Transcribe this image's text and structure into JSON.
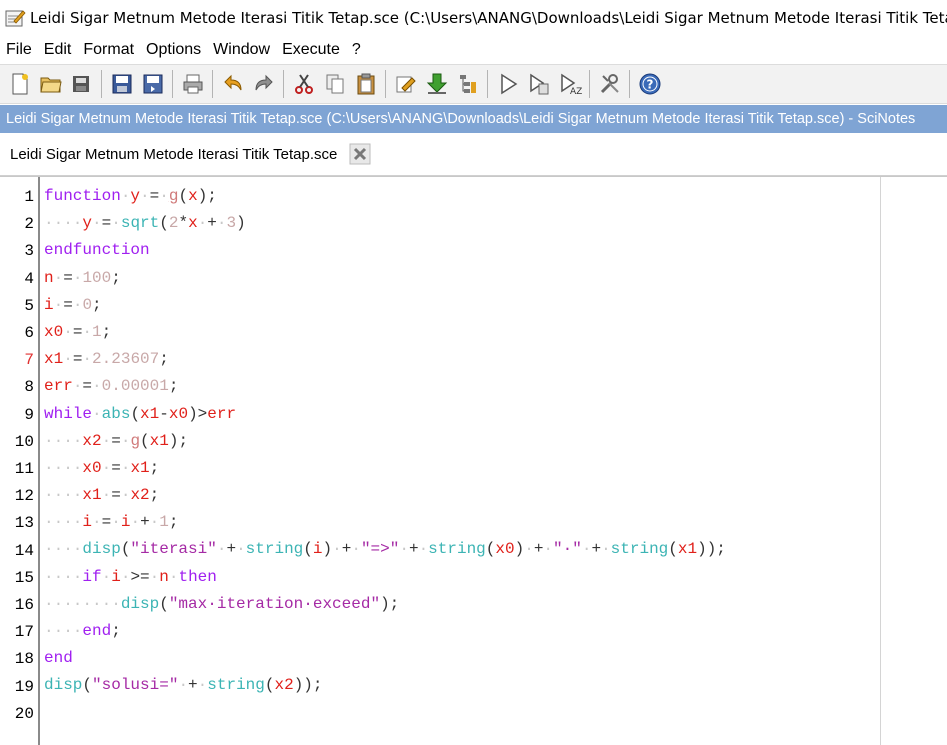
{
  "window": {
    "title": "Leidi Sigar Metnum Metode Iterasi Titik Tetap.sce (C:\\Users\\ANANG\\Downloads\\Leidi Sigar Metnum Metode Iterasi Titik Tetap.sce) - SciNotes"
  },
  "menu": {
    "items": [
      "File",
      "Edit",
      "Format",
      "Options",
      "Window",
      "Execute",
      "?"
    ]
  },
  "toolbar": {
    "icons": [
      "new-file-icon",
      "open-file-icon",
      "open-directory-icon",
      "save-icon",
      "save-as-icon",
      "print-icon",
      "undo-icon",
      "redo-icon",
      "cut-icon",
      "copy-icon",
      "paste-icon",
      "find-replace-icon",
      "load-into-scilab-icon",
      "variable-browser-icon",
      "execute-icon",
      "execute-file-icon",
      "execute-until-cursor-icon",
      "preferences-icon",
      "help-icon"
    ]
  },
  "pathbar": {
    "text": "Leidi Sigar Metnum Metode Iterasi Titik Tetap.sce (C:\\Users\\ANANG\\Downloads\\Leidi Sigar Metnum Metode Iterasi Titik Tetap.sce) - SciNotes"
  },
  "tab": {
    "label": "Leidi Sigar Metnum Metode Iterasi Titik Tetap.sce"
  },
  "editor": {
    "line_numbers": [
      "1",
      "2",
      "3",
      "4",
      "5",
      "6",
      "7",
      "8",
      "9",
      "10",
      "11",
      "12",
      "13",
      "14",
      "15",
      "16",
      "17",
      "18",
      "19",
      "20"
    ],
    "highlighted_line": "7",
    "code_lines": [
      [
        {
          "t": "function",
          "c": "kw"
        },
        {
          "t": "·",
          "c": "ws"
        },
        {
          "t": "y",
          "c": "var"
        },
        {
          "t": "·",
          "c": "ws"
        },
        {
          "t": "=",
          "c": "op"
        },
        {
          "t": "·",
          "c": "ws"
        },
        {
          "t": "g",
          "c": "u"
        },
        {
          "t": "(",
          "c": "p"
        },
        {
          "t": "x",
          "c": "var"
        },
        {
          "t": ");",
          "c": "p"
        }
      ],
      [
        {
          "t": "····",
          "c": "ws"
        },
        {
          "t": "y",
          "c": "var"
        },
        {
          "t": "·",
          "c": "ws"
        },
        {
          "t": "=",
          "c": "op"
        },
        {
          "t": "·",
          "c": "ws"
        },
        {
          "t": "sqrt",
          "c": "fn"
        },
        {
          "t": "(",
          "c": "p"
        },
        {
          "t": "2",
          "c": "num"
        },
        {
          "t": "*",
          "c": "op"
        },
        {
          "t": "x",
          "c": "var"
        },
        {
          "t": "·",
          "c": "ws"
        },
        {
          "t": "+",
          "c": "op"
        },
        {
          "t": "·",
          "c": "ws"
        },
        {
          "t": "3",
          "c": "num"
        },
        {
          "t": ")",
          "c": "p"
        }
      ],
      [
        {
          "t": "endfunction",
          "c": "kw"
        }
      ],
      [
        {
          "t": "n",
          "c": "var"
        },
        {
          "t": "·",
          "c": "ws"
        },
        {
          "t": "=",
          "c": "op"
        },
        {
          "t": "·",
          "c": "ws"
        },
        {
          "t": "100",
          "c": "num"
        },
        {
          "t": ";",
          "c": "p"
        }
      ],
      [
        {
          "t": "i",
          "c": "var"
        },
        {
          "t": "·",
          "c": "ws"
        },
        {
          "t": "=",
          "c": "op"
        },
        {
          "t": "·",
          "c": "ws"
        },
        {
          "t": "0",
          "c": "num"
        },
        {
          "t": ";",
          "c": "p"
        }
      ],
      [
        {
          "t": "x0",
          "c": "var"
        },
        {
          "t": "·",
          "c": "ws"
        },
        {
          "t": "=",
          "c": "op"
        },
        {
          "t": "·",
          "c": "ws"
        },
        {
          "t": "1",
          "c": "num"
        },
        {
          "t": ";",
          "c": "p"
        }
      ],
      [
        {
          "t": "x1",
          "c": "var"
        },
        {
          "t": "·",
          "c": "ws"
        },
        {
          "t": "=",
          "c": "op"
        },
        {
          "t": "·",
          "c": "ws"
        },
        {
          "t": "2.23607",
          "c": "num"
        },
        {
          "t": ";",
          "c": "p"
        }
      ],
      [
        {
          "t": "err",
          "c": "var"
        },
        {
          "t": "·",
          "c": "ws"
        },
        {
          "t": "=",
          "c": "op"
        },
        {
          "t": "·",
          "c": "ws"
        },
        {
          "t": "0.00001",
          "c": "num"
        },
        {
          "t": ";",
          "c": "p"
        }
      ],
      [
        {
          "t": "while",
          "c": "kw"
        },
        {
          "t": "·",
          "c": "ws"
        },
        {
          "t": "abs",
          "c": "fn"
        },
        {
          "t": "(",
          "c": "p"
        },
        {
          "t": "x1",
          "c": "var"
        },
        {
          "t": "-",
          "c": "op"
        },
        {
          "t": "x0",
          "c": "var"
        },
        {
          "t": ")",
          "c": "p"
        },
        {
          "t": ">",
          "c": "op"
        },
        {
          "t": "err",
          "c": "var"
        }
      ],
      [
        {
          "t": "····",
          "c": "ws"
        },
        {
          "t": "x2",
          "c": "var"
        },
        {
          "t": "·",
          "c": "ws"
        },
        {
          "t": "=",
          "c": "op"
        },
        {
          "t": "·",
          "c": "ws"
        },
        {
          "t": "g",
          "c": "u"
        },
        {
          "t": "(",
          "c": "p"
        },
        {
          "t": "x1",
          "c": "var"
        },
        {
          "t": ");",
          "c": "p"
        }
      ],
      [
        {
          "t": "····",
          "c": "ws"
        },
        {
          "t": "x0",
          "c": "var"
        },
        {
          "t": "·",
          "c": "ws"
        },
        {
          "t": "=",
          "c": "op"
        },
        {
          "t": "·",
          "c": "ws"
        },
        {
          "t": "x1",
          "c": "var"
        },
        {
          "t": ";",
          "c": "p"
        }
      ],
      [
        {
          "t": "····",
          "c": "ws"
        },
        {
          "t": "x1",
          "c": "var"
        },
        {
          "t": "·",
          "c": "ws"
        },
        {
          "t": "=",
          "c": "op"
        },
        {
          "t": "·",
          "c": "ws"
        },
        {
          "t": "x2",
          "c": "var"
        },
        {
          "t": ";",
          "c": "p"
        }
      ],
      [
        {
          "t": "····",
          "c": "ws"
        },
        {
          "t": "i",
          "c": "var"
        },
        {
          "t": "·",
          "c": "ws"
        },
        {
          "t": "=",
          "c": "op"
        },
        {
          "t": "·",
          "c": "ws"
        },
        {
          "t": "i",
          "c": "var"
        },
        {
          "t": "·",
          "c": "ws"
        },
        {
          "t": "+",
          "c": "op"
        },
        {
          "t": "·",
          "c": "ws"
        },
        {
          "t": "1",
          "c": "num"
        },
        {
          "t": ";",
          "c": "p"
        }
      ],
      [
        {
          "t": "····",
          "c": "ws"
        },
        {
          "t": "disp",
          "c": "fn"
        },
        {
          "t": "(",
          "c": "p"
        },
        {
          "t": "\"iterasi\"",
          "c": "str"
        },
        {
          "t": "·",
          "c": "ws"
        },
        {
          "t": "+",
          "c": "op"
        },
        {
          "t": "·",
          "c": "ws"
        },
        {
          "t": "string",
          "c": "fn"
        },
        {
          "t": "(",
          "c": "p"
        },
        {
          "t": "i",
          "c": "var"
        },
        {
          "t": ")",
          "c": "p"
        },
        {
          "t": "·",
          "c": "ws"
        },
        {
          "t": "+",
          "c": "op"
        },
        {
          "t": "·",
          "c": "ws"
        },
        {
          "t": "\"=>\"",
          "c": "str"
        },
        {
          "t": "·",
          "c": "ws"
        },
        {
          "t": "+",
          "c": "op"
        },
        {
          "t": "·",
          "c": "ws"
        },
        {
          "t": "string",
          "c": "fn"
        },
        {
          "t": "(",
          "c": "p"
        },
        {
          "t": "x0",
          "c": "var"
        },
        {
          "t": ")",
          "c": "p"
        },
        {
          "t": "·",
          "c": "ws"
        },
        {
          "t": "+",
          "c": "op"
        },
        {
          "t": "·",
          "c": "ws"
        },
        {
          "t": "\"·\"",
          "c": "str"
        },
        {
          "t": "·",
          "c": "ws"
        },
        {
          "t": "+",
          "c": "op"
        },
        {
          "t": "·",
          "c": "ws"
        },
        {
          "t": "string",
          "c": "fn"
        },
        {
          "t": "(",
          "c": "p"
        },
        {
          "t": "x1",
          "c": "var"
        },
        {
          "t": "));",
          "c": "p"
        }
      ],
      [
        {
          "t": "····",
          "c": "ws"
        },
        {
          "t": "if",
          "c": "kw"
        },
        {
          "t": "·",
          "c": "ws"
        },
        {
          "t": "i",
          "c": "var"
        },
        {
          "t": "·",
          "c": "ws"
        },
        {
          "t": ">=",
          "c": "op"
        },
        {
          "t": "·",
          "c": "ws"
        },
        {
          "t": "n",
          "c": "var"
        },
        {
          "t": "·",
          "c": "ws"
        },
        {
          "t": "then",
          "c": "kw"
        }
      ],
      [
        {
          "t": "········",
          "c": "ws"
        },
        {
          "t": "disp",
          "c": "fn"
        },
        {
          "t": "(",
          "c": "p"
        },
        {
          "t": "\"max·iteration·exceed\"",
          "c": "str"
        },
        {
          "t": ");",
          "c": "p"
        }
      ],
      [
        {
          "t": "····",
          "c": "ws"
        },
        {
          "t": "end",
          "c": "kw"
        },
        {
          "t": ";",
          "c": "p"
        }
      ],
      [
        {
          "t": "end",
          "c": "kw"
        }
      ],
      [
        {
          "t": "disp",
          "c": "fn"
        },
        {
          "t": "(",
          "c": "p"
        },
        {
          "t": "\"solusi=\"",
          "c": "str"
        },
        {
          "t": "·",
          "c": "ws"
        },
        {
          "t": "+",
          "c": "op"
        },
        {
          "t": "·",
          "c": "ws"
        },
        {
          "t": "string",
          "c": "fn"
        },
        {
          "t": "(",
          "c": "p"
        },
        {
          "t": "x2",
          "c": "var"
        },
        {
          "t": "));",
          "c": "p"
        }
      ],
      []
    ]
  }
}
